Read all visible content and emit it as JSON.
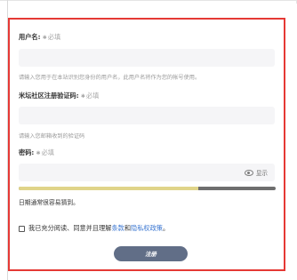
{
  "form": {
    "username": {
      "label": "用户名:",
      "required": "必填",
      "hint": "请输入您用于在本站识别您身份的用户名，此用户名将作为您的帐号使用。"
    },
    "code": {
      "label": "米坛社区注册验证码:",
      "required": "必填",
      "hint": "请输入您邮箱收到的验证码"
    },
    "password": {
      "label": "密码:",
      "required": "必填",
      "toggle": "显示",
      "strength_text": "日期通常很容易猜到。",
      "strength_level": 0.7
    },
    "agreement": {
      "prefix": "我已充分阅读、同意并且理解",
      "terms": "条款",
      "and": "和",
      "privacy": "隐私权政策",
      "suffix": "。"
    },
    "submit_label": "注册"
  },
  "colors": {
    "frame": "#e53935",
    "strength_fill": "#e0d489",
    "button": "#616e87",
    "link": "#3a76d1"
  },
  "icons": {
    "required": "asterisk-icon",
    "toggle": "eye-icon",
    "agree": "checkbox-icon"
  }
}
